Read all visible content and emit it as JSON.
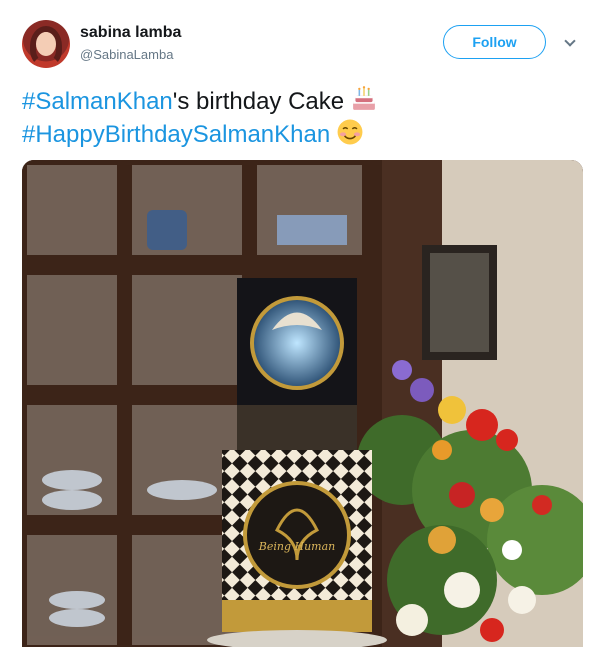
{
  "author": {
    "display_name": "sabina lamba",
    "handle": "@SabinaLamba"
  },
  "follow_label": "Follow",
  "tweet": {
    "line1_hashtag": "#SalmanKhan",
    "line1_text": "'s birthday Cake",
    "line2_hashtag": "#HappyBirthdaySalmanKhan"
  },
  "media": {
    "cake_inscription": "Being Human"
  },
  "colors": {
    "link": "#1b95e0",
    "follow": "#1da1f2",
    "text": "#14171a",
    "muted": "#657786"
  },
  "icons": [
    "birthday-cake-emoji-icon",
    "smiling-blush-emoji-icon",
    "chevron-down-icon"
  ]
}
